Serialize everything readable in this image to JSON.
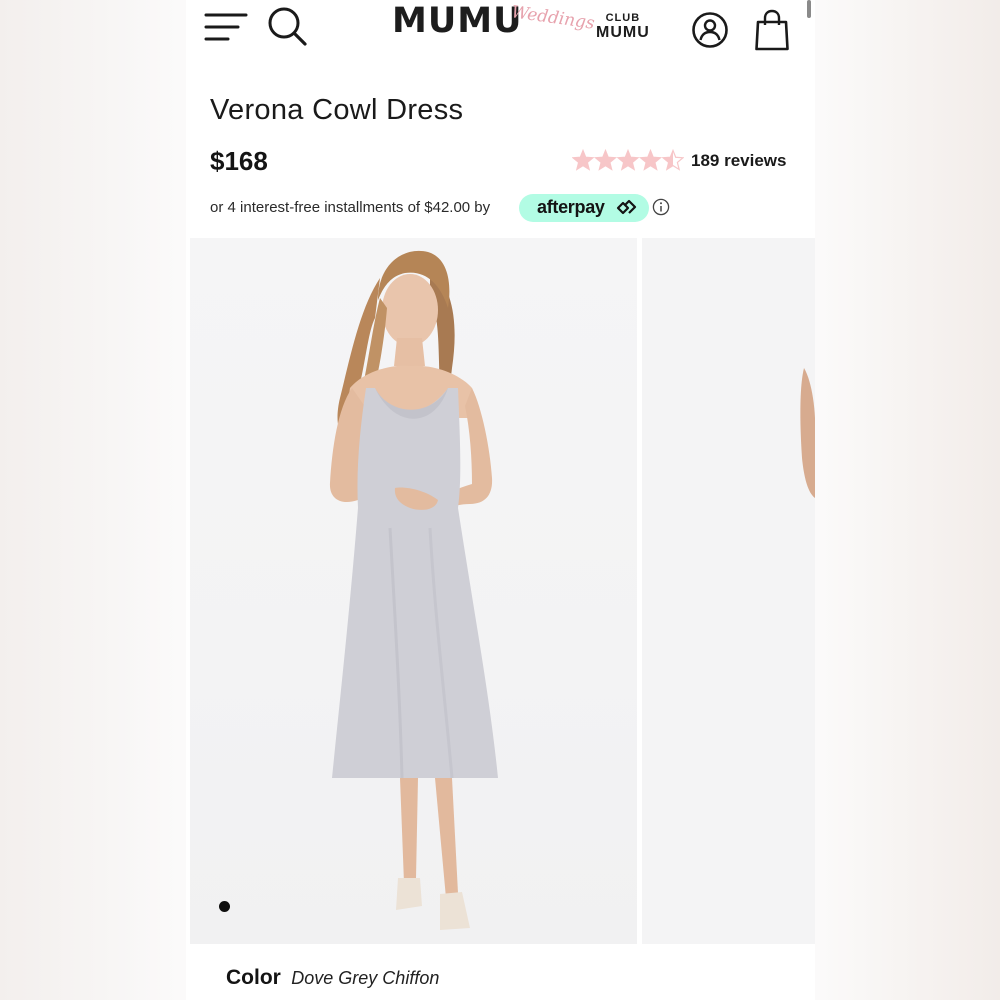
{
  "header": {
    "logo_main": "MUMU",
    "logo_script": "Weddings",
    "club_top": "CLUB",
    "club_bottom": "MUMU"
  },
  "product": {
    "title": "Verona Cowl Dress",
    "price": "$168",
    "rating_value": 4.5,
    "rating_max": 5,
    "reviews_label": "189 reviews",
    "afterpay_text": "or 4 interest-free installments of $42.00 by",
    "afterpay_brand": "afterpay",
    "color_label": "Color",
    "color_value": "Dove Grey Chiffon"
  },
  "gallery": {
    "active_slide": 1
  },
  "colors": {
    "star_fill": "#f7c6c8",
    "afterpay_badge": "#b2fce4",
    "logo_script": "#e7a2ad",
    "dress": "#cfcfd6"
  },
  "icons": [
    "menu-icon",
    "search-icon",
    "account-icon",
    "bag-icon",
    "star-icon",
    "info-icon",
    "afterpay-arrow-icon"
  ]
}
